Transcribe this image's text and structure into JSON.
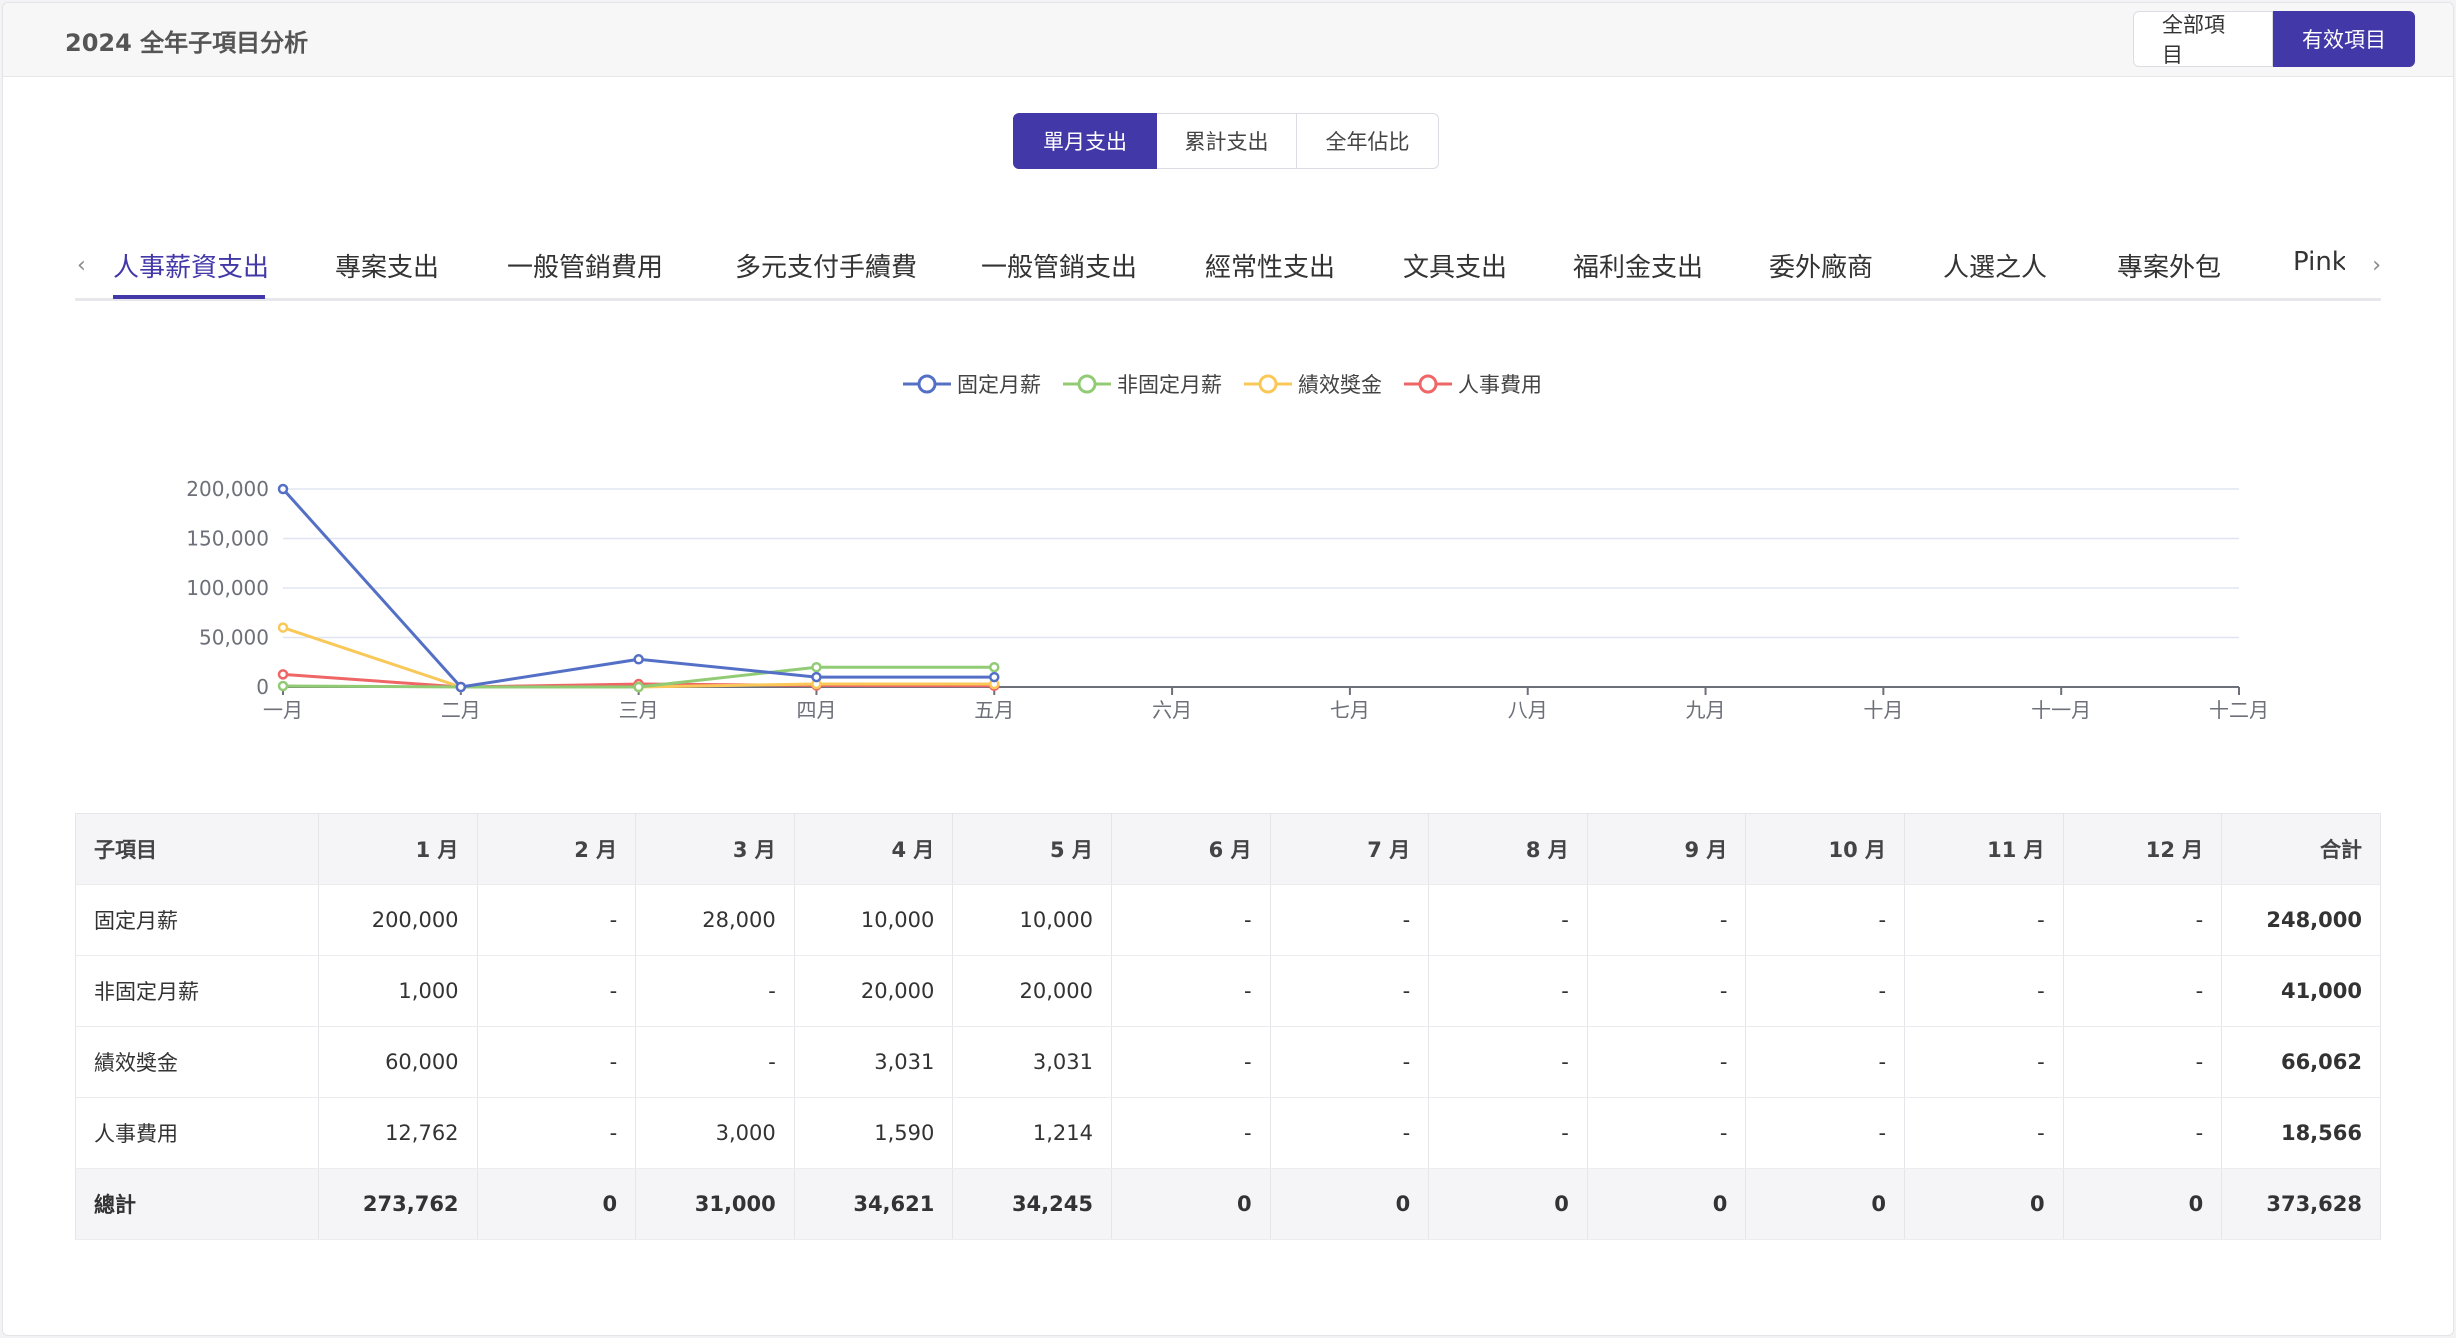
{
  "header": {
    "title": "2024 全年子項目分析",
    "btn_all": "全部項目",
    "btn_active": "有效項目"
  },
  "segment": {
    "monthly": "單月支出",
    "cumulative": "累計支出",
    "ratio": "全年佔比"
  },
  "tabs": [
    "人事薪資支出",
    "專案支出",
    "一般管銷費用",
    "多元支付手續費",
    "一般管銷支出",
    "經常性支出",
    "文具支出",
    "福利金支出",
    "委外廠商",
    "人選之人",
    "專案外包",
    "Pinkoi"
  ],
  "tab_arrows": {
    "left": "‹",
    "right": "›"
  },
  "chart_data": {
    "type": "line",
    "categories": [
      "一月",
      "二月",
      "三月",
      "四月",
      "五月",
      "六月",
      "七月",
      "八月",
      "九月",
      "十月",
      "十一月",
      "十二月"
    ],
    "yticks": [
      "0",
      "50,000",
      "100,000",
      "150,000",
      "200,000"
    ],
    "ylim": [
      0,
      200000
    ],
    "grid": true,
    "legend": "top-center",
    "series": [
      {
        "name": "固定月薪",
        "color": "#5470c6",
        "values": [
          200000,
          0,
          28000,
          10000,
          10000
        ]
      },
      {
        "name": "非固定月薪",
        "color": "#91cc75",
        "values": [
          1000,
          0,
          0,
          20000,
          20000
        ]
      },
      {
        "name": "績效獎金",
        "color": "#fac858",
        "values": [
          60000,
          0,
          0,
          3031,
          3031
        ]
      },
      {
        "name": "人事費用",
        "color": "#ee6666",
        "values": [
          12762,
          0,
          3000,
          1590,
          1214
        ]
      }
    ]
  },
  "table": {
    "headers": [
      "子項目",
      "1 月",
      "2 月",
      "3 月",
      "4 月",
      "5 月",
      "6 月",
      "7 月",
      "8 月",
      "9 月",
      "10 月",
      "11 月",
      "12 月",
      "合計"
    ],
    "rows": [
      [
        "固定月薪",
        "200,000",
        "-",
        "28,000",
        "10,000",
        "10,000",
        "-",
        "-",
        "-",
        "-",
        "-",
        "-",
        "-",
        "248,000"
      ],
      [
        "非固定月薪",
        "1,000",
        "-",
        "-",
        "20,000",
        "20,000",
        "-",
        "-",
        "-",
        "-",
        "-",
        "-",
        "-",
        "41,000"
      ],
      [
        "績效獎金",
        "60,000",
        "-",
        "-",
        "3,031",
        "3,031",
        "-",
        "-",
        "-",
        "-",
        "-",
        "-",
        "-",
        "66,062"
      ],
      [
        "人事費用",
        "12,762",
        "-",
        "3,000",
        "1,590",
        "1,214",
        "-",
        "-",
        "-",
        "-",
        "-",
        "-",
        "-",
        "18,566"
      ]
    ],
    "total": [
      "總計",
      "273,762",
      "0",
      "31,000",
      "34,621",
      "34,245",
      "0",
      "0",
      "0",
      "0",
      "0",
      "0",
      "0",
      "373,628"
    ]
  }
}
